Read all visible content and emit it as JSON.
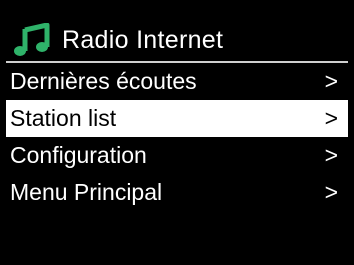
{
  "header": {
    "icon": "music-note-icon",
    "icon_color": "#2fb36a",
    "title": "Radio Internet"
  },
  "menu": {
    "items": [
      {
        "label": "Dernières écoutes",
        "chevron": ">",
        "selected": false
      },
      {
        "label": "Station list",
        "chevron": ">",
        "selected": true
      },
      {
        "label": "Configuration",
        "chevron": ">",
        "selected": false
      },
      {
        "label": "Menu Principal",
        "chevron": ">",
        "selected": false
      }
    ]
  },
  "colors": {
    "background": "#000000",
    "text": "#ffffff",
    "highlight": "#ffffff",
    "highlight_text": "#000000"
  }
}
